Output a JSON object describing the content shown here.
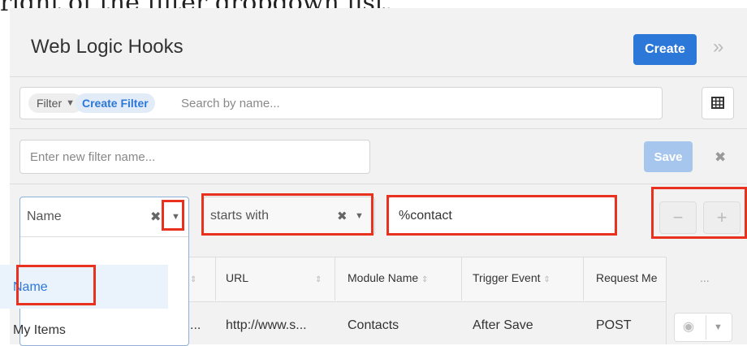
{
  "caption_fragment": "right of the filter dropdown list.",
  "header": {
    "title": "Web Logic Hooks",
    "create_label": "Create",
    "collapse_icon": "double-chevron-right-icon"
  },
  "filter_bar": {
    "filter_label": "Filter",
    "create_filter_label": "Create Filter",
    "search_placeholder": "Search by name..."
  },
  "new_filter": {
    "name_placeholder": "Enter new filter name...",
    "save_label": "Save"
  },
  "filter_row": {
    "field_selected": "Name",
    "operator_selected": "starts with",
    "value": "%contact",
    "options": [
      "Name",
      "My Items"
    ]
  },
  "table": {
    "columns": [
      "URL",
      "Module Name",
      "Trigger Event",
      "Request Me",
      "..."
    ],
    "rows": [
      {
        "name": "...",
        "url": "http://www.s...",
        "module": "Contacts",
        "trigger": "After Save",
        "request": "POST"
      }
    ]
  },
  "colors": {
    "accent": "#2c78d8",
    "highlight": "#e8321f"
  }
}
